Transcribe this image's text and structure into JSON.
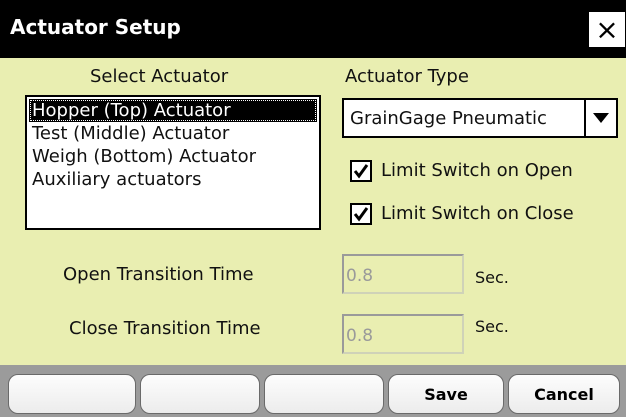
{
  "window": {
    "title": "Actuator Setup",
    "close_glyph": "×",
    "close_icon": "close-icon"
  },
  "select_actuator": {
    "label": "Select Actuator",
    "items": [
      {
        "label": "Hopper (Top) Actuator",
        "selected": true
      },
      {
        "label": "Test (Middle) Actuator",
        "selected": false
      },
      {
        "label": "Weigh (Bottom) Actuator",
        "selected": false
      },
      {
        "label": "Auxiliary actuators",
        "selected": false
      }
    ]
  },
  "actuator_type": {
    "label": "Actuator Type",
    "value": "GrainGage Pneumatic",
    "arrow_icon": "chevron-down-icon"
  },
  "limit_switches": {
    "open": {
      "label": "Limit Switch on Open",
      "checked": true
    },
    "close": {
      "label": "Limit Switch on Close",
      "checked": true
    }
  },
  "transition": {
    "open": {
      "label": "Open Transition Time",
      "value": "0.8",
      "unit": "Sec.",
      "disabled": true
    },
    "close": {
      "label": "Close Transition Time",
      "value": "0.8",
      "unit": "Sec.",
      "disabled": true
    }
  },
  "toolbar": {
    "buttons": [
      "",
      "",
      "",
      "Save",
      "Cancel"
    ]
  },
  "colors": {
    "background": "#e9eeb1",
    "titlebar": "#000000",
    "toolbar": "#9b9b9b",
    "disabled_text": "#9a9a9a"
  }
}
